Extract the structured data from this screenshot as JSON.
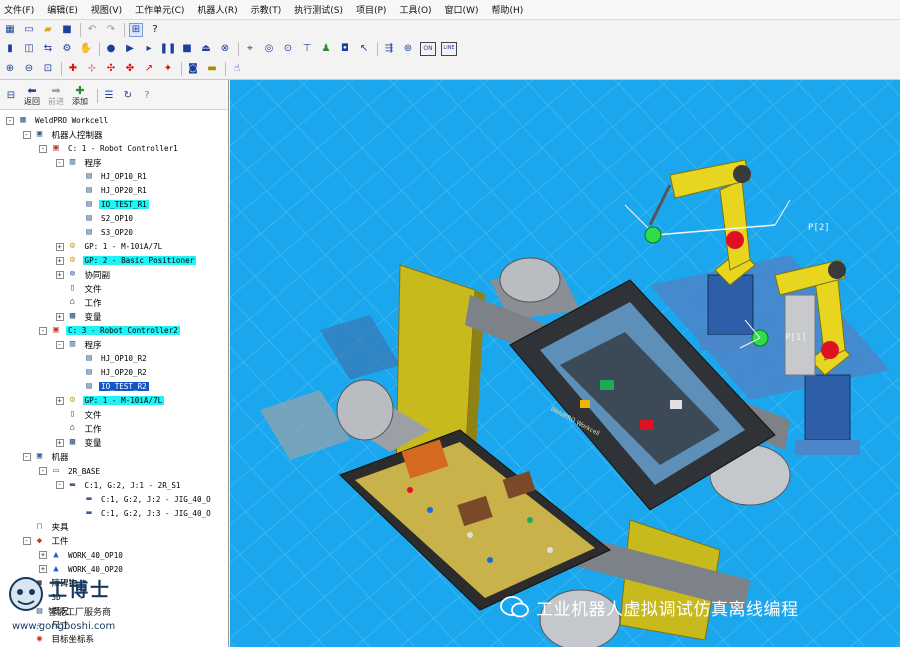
{
  "menu": [
    "文件(F)",
    "编辑(E)",
    "视图(V)",
    "工作单元(C)",
    "机器人(R)",
    "示教(T)",
    "执行测试(S)",
    "项目(P)",
    "工具(O)",
    "窗口(W)",
    "帮助(H)"
  ],
  "toolbar1_icons": [
    "grid-icon",
    "new-file-icon",
    "open-folder-icon",
    "save-icon",
    "undo-icon",
    "redo-icon",
    "tree-icon",
    "help-icon"
  ],
  "toolbar2_icons": [
    "teach-pendant-icon",
    "position-icon",
    "jog-icon",
    "joint-icon",
    "robot-hand-icon",
    "record-icon",
    "play-icon",
    "run-arrow-icon",
    "pause-icon",
    "stop-icon",
    "eject-icon",
    "abort-icon",
    "teach-icon",
    "dial-icon",
    "target-icon",
    "gate-icon",
    "gauge-icon",
    "person-icon",
    "camera-icon",
    "cursor-icon",
    "signal-icon",
    "online-icon",
    "offline-icon"
  ],
  "toolbar3_icons": [
    "zoom-in-icon",
    "zoom-out-icon",
    "zoom-fit-icon",
    "move-icon",
    "frame-icon",
    "snap-icon",
    "snap-target-icon",
    "axis-icon",
    "collision-icon",
    "camera-view-icon",
    "ruler-icon",
    "hand-icon"
  ],
  "nav": {
    "back": "返回",
    "forward": "前进",
    "add": "添加"
  },
  "tree": [
    {
      "label": "WeldPRO Workcell",
      "depth": 0,
      "icon": "workcell-icon",
      "exp": "-"
    },
    {
      "label": "机器人控制器",
      "depth": 1,
      "icon": "controller-group-icon",
      "exp": "-"
    },
    {
      "label": "C: 1 - Robot Controller1",
      "depth": 2,
      "icon": "controller-icon",
      "exp": "-"
    },
    {
      "label": "程序",
      "depth": 3,
      "icon": "program-folder-icon",
      "exp": "-"
    },
    {
      "label": "HJ_OP10_R1",
      "depth": 4,
      "icon": "program-icon"
    },
    {
      "label": "HJ_OP20_R1",
      "depth": 4,
      "icon": "program-icon"
    },
    {
      "label": "IO_TEST_R1",
      "depth": 4,
      "icon": "program-io-icon",
      "hl": "cyan"
    },
    {
      "label": "S2_OP10",
      "depth": 4,
      "icon": "program-icon"
    },
    {
      "label": "S3_OP20",
      "depth": 4,
      "icon": "program-icon"
    },
    {
      "label": "GP: 1 - M-10iA/7L",
      "depth": 3,
      "icon": "robot-arm-icon",
      "exp": "+"
    },
    {
      "label": "GP: 2 - Basic Positioner",
      "depth": 3,
      "icon": "positioner-icon",
      "exp": "+",
      "hl": "cyan"
    },
    {
      "label": "协同副",
      "depth": 3,
      "icon": "coordinated-icon",
      "exp": "+"
    },
    {
      "label": "文件",
      "depth": 3,
      "icon": "file-icon"
    },
    {
      "label": "工作",
      "depth": 3,
      "icon": "job-icon"
    },
    {
      "label": "变量",
      "depth": 3,
      "icon": "variable-icon",
      "exp": "+"
    },
    {
      "label": "C: 3 - Robot Controller2",
      "depth": 2,
      "icon": "controller-icon",
      "exp": "-",
      "hl": "cyan"
    },
    {
      "label": "程序",
      "depth": 3,
      "icon": "program-folder-icon",
      "exp": "-"
    },
    {
      "label": "HJ_OP10_R2",
      "depth": 4,
      "icon": "program-icon"
    },
    {
      "label": "HJ_OP20_R2",
      "depth": 4,
      "icon": "program-icon"
    },
    {
      "label": "IO_TEST_R2",
      "depth": 4,
      "icon": "program-io-icon",
      "hl": "blue"
    },
    {
      "label": "GP: 1 - M-10iA/7L",
      "depth": 3,
      "icon": "robot-arm-icon",
      "exp": "+",
      "hl": "cyan"
    },
    {
      "label": "文件",
      "depth": 3,
      "icon": "file-icon"
    },
    {
      "label": "工作",
      "depth": 3,
      "icon": "job-icon"
    },
    {
      "label": "变量",
      "depth": 3,
      "icon": "variable-icon",
      "exp": "+"
    },
    {
      "label": "机器",
      "depth": 1,
      "icon": "machine-group-icon",
      "exp": "-"
    },
    {
      "label": "2R_BASE",
      "depth": 2,
      "icon": "machine-icon",
      "exp": "-"
    },
    {
      "label": "C:1, G:2, J:1 - 2R_S1",
      "depth": 3,
      "icon": "link-icon",
      "exp": "-"
    },
    {
      "label": "C:1, G:2, J:2 - JIG_40_O",
      "depth": 4,
      "icon": "link-icon"
    },
    {
      "label": "C:1, G:2, J:3 - JIG_40_O",
      "depth": 4,
      "icon": "link-icon"
    },
    {
      "label": "夹具",
      "depth": 1,
      "icon": "fixture-icon"
    },
    {
      "label": "工件",
      "depth": 1,
      "icon": "part-icon",
      "exp": "-"
    },
    {
      "label": "WORK_40_OP10",
      "depth": 2,
      "icon": "part-item-icon",
      "exp": "+"
    },
    {
      "label": "WORK_40_OP20",
      "depth": 2,
      "icon": "part-item-icon",
      "exp": "+"
    },
    {
      "label": "障碍物",
      "depth": 1,
      "icon": "obstacle-icon"
    },
    {
      "label": "3D",
      "depth": 1,
      "icon": "model-icon"
    },
    {
      "label": "概况",
      "depth": 1,
      "icon": "overview-icon"
    },
    {
      "label": "尺寸",
      "depth": 1,
      "icon": "dimension-icon"
    },
    {
      "label": "目标坐标系",
      "depth": 1,
      "icon": "target-frame-icon"
    }
  ],
  "viewport": {
    "robot_labels": [
      "P[2]",
      "P[1]"
    ],
    "wall_text": "WeldPRO Workcell"
  },
  "watermark_left": {
    "title": "工博士",
    "subtitle": "智能工厂服务商",
    "url": "www.gongboshi.com"
  },
  "watermark_right": {
    "text": "工业机器人虚拟调试仿真离线编程"
  },
  "colors": {
    "viewport_bg": "#1ba7ee",
    "grid": "#58c6f5",
    "highlight_cyan": "#1ff3f6",
    "highlight_blue": "#1257c6",
    "robot_yellow": "#e7d51f"
  }
}
